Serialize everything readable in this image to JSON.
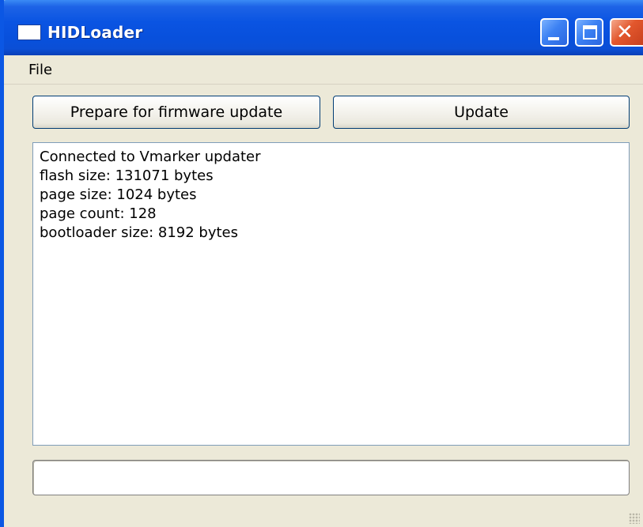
{
  "window": {
    "title": "HIDLoader",
    "icon": "app-window-icon",
    "controls": {
      "minimize": "minimize-icon",
      "maximize": "maximize-icon",
      "close": "close-icon",
      "close_glyph": "✕"
    }
  },
  "menu": {
    "items": [
      {
        "label": "File"
      }
    ]
  },
  "toolbar": {
    "prepare_label": "Prepare for firmware update",
    "update_label": "Update"
  },
  "log": {
    "lines": [
      "Connected to Vmarker updater",
      "flash size: 131071 bytes",
      "page size: 1024 bytes",
      "page count: 128",
      "bootloader size: 8192 bytes"
    ]
  },
  "progress": {
    "value": 0
  },
  "colors": {
    "titlebar": "#0a54e2",
    "window_bg": "#ece9d8",
    "close_button": "#e2572d",
    "button_border": "#003c74",
    "progress_fill": "#3c9e3c"
  }
}
